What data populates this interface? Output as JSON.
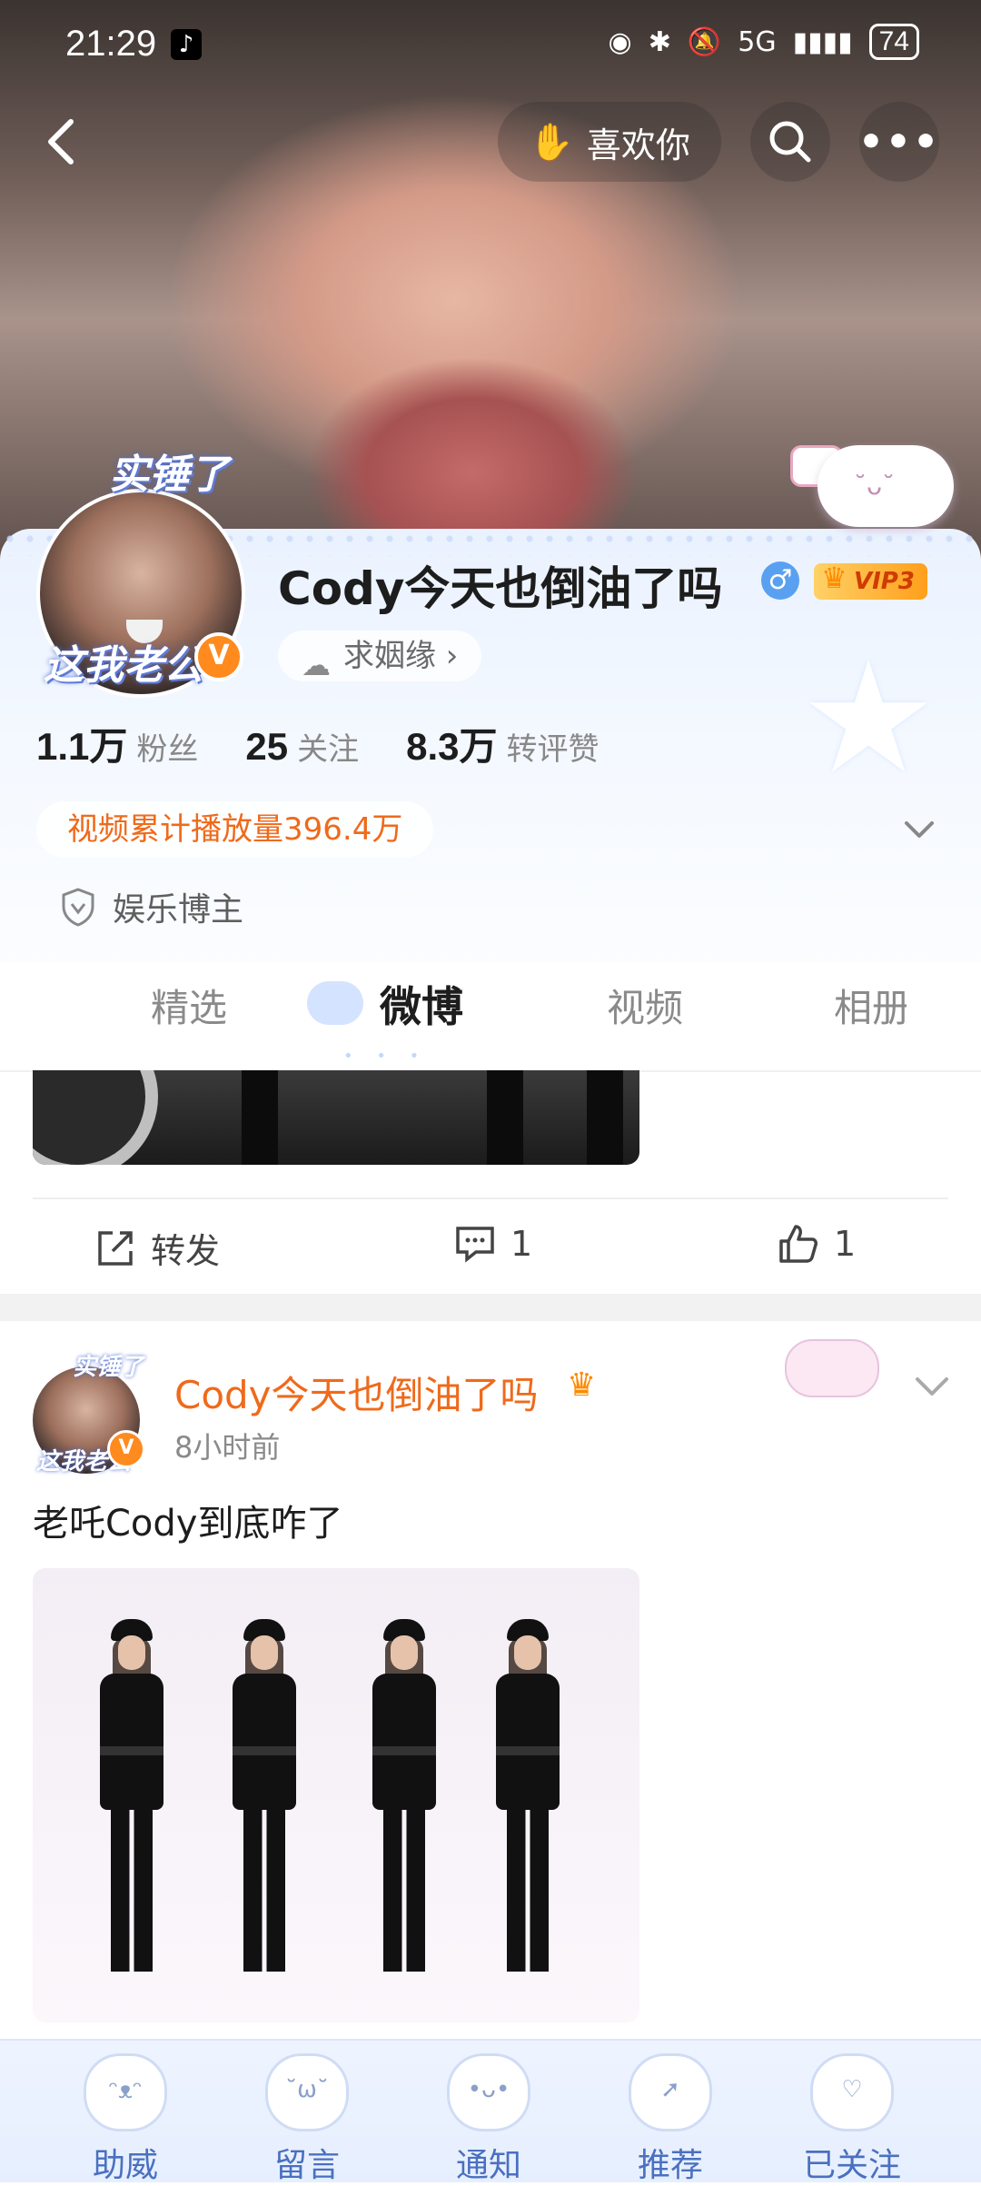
{
  "status_bar": {
    "time": "21:29",
    "tiktok_glyph": "♪",
    "network": "5G",
    "battery": "74"
  },
  "top_nav": {
    "like_label": "喜欢你"
  },
  "profile": {
    "avatar_sticker_top": "实锤了",
    "avatar_sticker_bottom": "这我老公",
    "verified_mark": "V",
    "username": "Cody今天也倒油了吗",
    "gender_symbol": "♂",
    "vip_label": "VIP3",
    "marriage_tag": "求姻缘 ›",
    "stats": [
      {
        "value": "1.1万",
        "label": "粉丝"
      },
      {
        "value": "25",
        "label": "关注"
      },
      {
        "value": "8.3万",
        "label": "转评赞"
      }
    ],
    "play_count": "视频累计播放量396.4万",
    "role": "娱乐博主"
  },
  "tabs": [
    {
      "label": "精选"
    },
    {
      "label": "微博"
    },
    {
      "label": "视频"
    },
    {
      "label": "相册"
    }
  ],
  "post1_actions": {
    "repost_label": "转发",
    "comment_count": "1",
    "like_count": "1"
  },
  "post2": {
    "sticker_top": "实锤了",
    "sticker_bottom": "这我老公",
    "author": "Cody今天也倒油了吗",
    "time": "8小时前",
    "text": "老吒Cody到底咋了"
  },
  "bottom_nav": [
    {
      "label": "助威"
    },
    {
      "label": "留言"
    },
    {
      "label": "通知"
    },
    {
      "label": "推荐"
    },
    {
      "label": "已关注"
    }
  ],
  "colors": {
    "accent_orange": "#ef6a1b",
    "tab_highlight": "#cfe0ff",
    "bottom_nav_text": "#4a70c0"
  }
}
